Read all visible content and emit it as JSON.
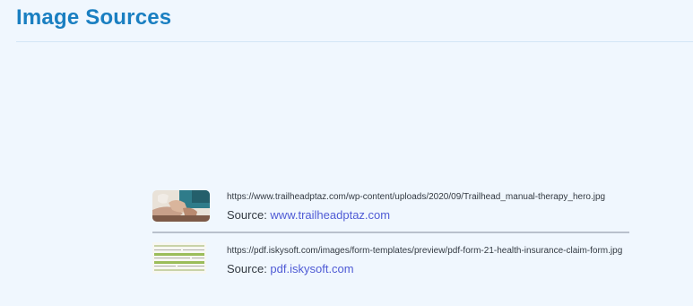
{
  "page": {
    "title": "Image Sources"
  },
  "sources": [
    {
      "url": "https://www.trailheadptaz.com/wp-content/uploads/2020/09/Trailhead_manual-therapy_hero.jpg",
      "source_prefix": "Source: ",
      "domain": "www.trailheadptaz.com",
      "thumbnail": "manual-therapy-photo"
    },
    {
      "url": "https://pdf.iskysoft.com/images/form-templates/preview/pdf-form-21-health-insurance-claim-form.jpg",
      "source_prefix": "Source: ",
      "domain": "pdf.iskysoft.com",
      "thumbnail": "claim-form-preview"
    }
  ],
  "colors": {
    "title": "#1a7fc1",
    "link": "#4f5bd5",
    "background": "#f0f7fe",
    "divider": "#b9c1cc"
  }
}
